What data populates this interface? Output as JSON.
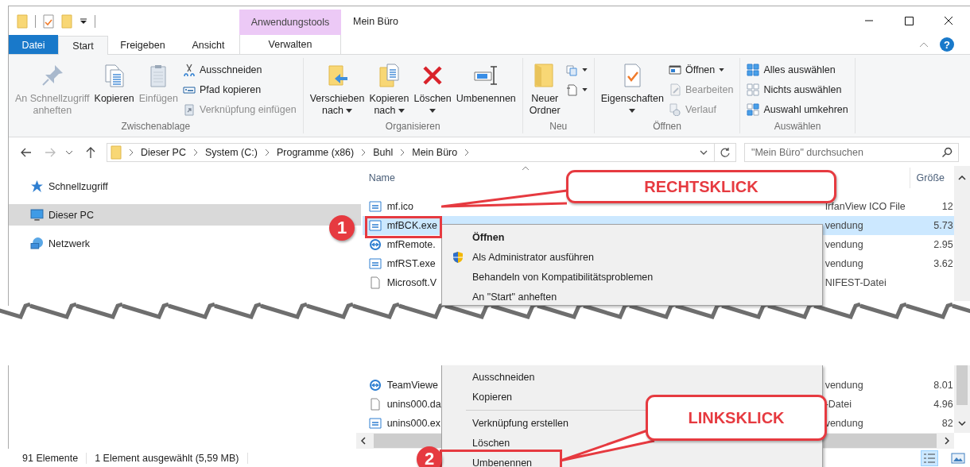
{
  "window": {
    "title": "Mein Büro",
    "context_header": "Anwendungstools",
    "help": "?"
  },
  "tabs": [
    {
      "label": "Datei",
      "kind": "file",
      "selected": false
    },
    {
      "label": "Start",
      "kind": "tab",
      "selected": true
    },
    {
      "label": "Freigeben",
      "kind": "tab",
      "selected": false
    },
    {
      "label": "Ansicht",
      "kind": "tab",
      "selected": false
    },
    {
      "label": "Verwalten",
      "kind": "context",
      "selected": false
    }
  ],
  "ribbon": {
    "groups": [
      {
        "label": "Zwischenablage",
        "large": [
          {
            "lines": [
              "An Schnellzugriff",
              "anheften"
            ],
            "disabled": true,
            "menu": false
          },
          {
            "lines": [
              "Kopieren"
            ],
            "disabled": false,
            "menu": false
          },
          {
            "lines": [
              "Einfügen"
            ],
            "disabled": true,
            "menu": false
          }
        ],
        "small": [
          {
            "label": "Ausschneiden",
            "disabled": false,
            "menu": false
          },
          {
            "label": "Pfad kopieren",
            "disabled": false,
            "menu": false
          },
          {
            "label": "Verknüpfung einfügen",
            "disabled": true,
            "menu": false
          }
        ]
      },
      {
        "label": "Organisieren",
        "large": [
          {
            "lines": [
              "Verschieben",
              "nach"
            ],
            "disabled": false,
            "menu": true
          },
          {
            "lines": [
              "Kopieren",
              "nach"
            ],
            "disabled": false,
            "menu": true
          },
          {
            "lines": [
              "Löschen"
            ],
            "disabled": false,
            "menu": true
          },
          {
            "lines": [
              "Umbenennen"
            ],
            "disabled": false,
            "menu": false
          }
        ]
      },
      {
        "label": "Neu",
        "large": [
          {
            "lines": [
              "Neuer",
              "Ordner"
            ],
            "disabled": false,
            "menu": false
          }
        ],
        "small": [
          {
            "menu": true
          },
          {
            "menu": true
          }
        ]
      },
      {
        "label": "Öffnen",
        "large": [
          {
            "lines": [
              "Eigenschaften"
            ],
            "disabled": false,
            "menu": true
          }
        ],
        "small": [
          {
            "label": "Öffnen",
            "disabled": false,
            "menu": true
          },
          {
            "label": "Bearbeiten",
            "disabled": true,
            "menu": false
          },
          {
            "label": "Verlauf",
            "disabled": true,
            "menu": false
          }
        ]
      },
      {
        "label": "Auswählen",
        "small": [
          {
            "label": "Alles auswählen",
            "disabled": false,
            "menu": false
          },
          {
            "label": "Nichts auswählen",
            "disabled": false,
            "menu": false
          },
          {
            "label": "Auswahl umkehren",
            "disabled": false,
            "menu": false
          }
        ]
      }
    ]
  },
  "address": {
    "path": [
      "Dieser PC",
      "System (C:)",
      "Programme (x86)",
      "Buhl",
      "Mein Büro"
    ],
    "search_placeholder": "\"Mein Büro\" durchsuchen"
  },
  "navigation": [
    {
      "label": "Schnellzugriff",
      "selected": false
    },
    {
      "label": "Dieser PC",
      "selected": true
    },
    {
      "label": "Netzwerk",
      "selected": false
    }
  ],
  "file_list": {
    "columns": [
      "Name",
      "Größe"
    ],
    "rows_top": [
      {
        "name": "mf.ico",
        "type": "IrfanView ICO File",
        "size": "12",
        "kind": "program",
        "selected": false
      },
      {
        "name": "mfBCK.exe",
        "type": "vendung",
        "size": "5.73",
        "kind": "program",
        "selected": true
      },
      {
        "name": "mfRemote.",
        "type": "vendung",
        "size": "2.95",
        "kind": "remote",
        "selected": false
      },
      {
        "name": "mfRST.exe",
        "type": "vendung",
        "size": "3.62",
        "kind": "program",
        "selected": false
      },
      {
        "name": "Microsoft.V",
        "type": "NIFEST-Datei",
        "kind": "document",
        "selected": false
      }
    ],
    "rows_bottom": [
      {
        "name": "TeamViewe",
        "type": "vendung",
        "size": "8.01",
        "kind": "remote",
        "selected": false
      },
      {
        "name": "unins000.da",
        "type": "-Datei",
        "size": "4.96",
        "kind": "document",
        "selected": false
      },
      {
        "name": "unins000.ex",
        "type": "vendung",
        "size": "82",
        "kind": "program",
        "selected": false
      }
    ]
  },
  "context_menu": {
    "items_top": [
      {
        "label": "Öffnen",
        "kind": "plain",
        "default": true
      },
      {
        "label": "Als Administrator ausführen",
        "kind": "elevated",
        "default": false
      },
      {
        "label": "Behandeln von Kompatibilitätsproblemen",
        "kind": "plain",
        "default": false
      },
      {
        "label": "An \"Start\" anheften",
        "kind": "plain",
        "default": false
      }
    ],
    "items_bottom": [
      {
        "label": "Ausschneiden",
        "default": false,
        "separator_after": false
      },
      {
        "label": "Kopieren",
        "default": false,
        "separator_after": true
      },
      {
        "label": "Verknüpfung erstellen",
        "default": false,
        "separator_after": false
      },
      {
        "label": "Löschen",
        "default": false,
        "separator_after": false
      },
      {
        "label": "Umbenennen",
        "default": false,
        "separator_after": false
      }
    ]
  },
  "callouts": [
    {
      "text": "RECHTSKLICK",
      "step": "1"
    },
    {
      "text": "LINKSKLICK",
      "step": "2"
    }
  ],
  "status_bar": {
    "count": "91 Elemente",
    "selection": "1 Element ausgewählt (5,59 MB)"
  }
}
